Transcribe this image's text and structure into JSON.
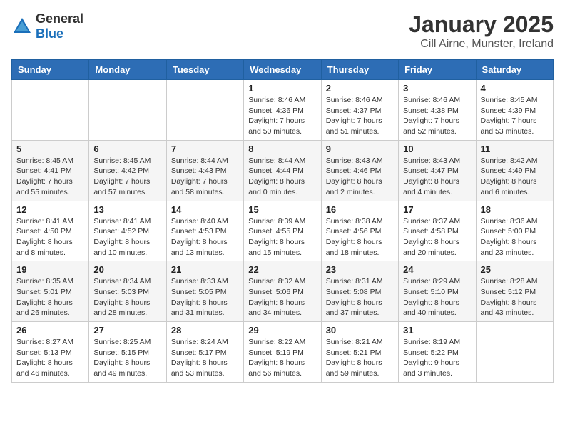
{
  "logo": {
    "general": "General",
    "blue": "Blue"
  },
  "title": "January 2025",
  "subtitle": "Cill Airne, Munster, Ireland",
  "days_header": [
    "Sunday",
    "Monday",
    "Tuesday",
    "Wednesday",
    "Thursday",
    "Friday",
    "Saturday"
  ],
  "weeks": [
    [
      {
        "day": "",
        "info": ""
      },
      {
        "day": "",
        "info": ""
      },
      {
        "day": "",
        "info": ""
      },
      {
        "day": "1",
        "info": "Sunrise: 8:46 AM\nSunset: 4:36 PM\nDaylight: 7 hours\nand 50 minutes."
      },
      {
        "day": "2",
        "info": "Sunrise: 8:46 AM\nSunset: 4:37 PM\nDaylight: 7 hours\nand 51 minutes."
      },
      {
        "day": "3",
        "info": "Sunrise: 8:46 AM\nSunset: 4:38 PM\nDaylight: 7 hours\nand 52 minutes."
      },
      {
        "day": "4",
        "info": "Sunrise: 8:45 AM\nSunset: 4:39 PM\nDaylight: 7 hours\nand 53 minutes."
      }
    ],
    [
      {
        "day": "5",
        "info": "Sunrise: 8:45 AM\nSunset: 4:41 PM\nDaylight: 7 hours\nand 55 minutes."
      },
      {
        "day": "6",
        "info": "Sunrise: 8:45 AM\nSunset: 4:42 PM\nDaylight: 7 hours\nand 57 minutes."
      },
      {
        "day": "7",
        "info": "Sunrise: 8:44 AM\nSunset: 4:43 PM\nDaylight: 7 hours\nand 58 minutes."
      },
      {
        "day": "8",
        "info": "Sunrise: 8:44 AM\nSunset: 4:44 PM\nDaylight: 8 hours\nand 0 minutes."
      },
      {
        "day": "9",
        "info": "Sunrise: 8:43 AM\nSunset: 4:46 PM\nDaylight: 8 hours\nand 2 minutes."
      },
      {
        "day": "10",
        "info": "Sunrise: 8:43 AM\nSunset: 4:47 PM\nDaylight: 8 hours\nand 4 minutes."
      },
      {
        "day": "11",
        "info": "Sunrise: 8:42 AM\nSunset: 4:49 PM\nDaylight: 8 hours\nand 6 minutes."
      }
    ],
    [
      {
        "day": "12",
        "info": "Sunrise: 8:41 AM\nSunset: 4:50 PM\nDaylight: 8 hours\nand 8 minutes."
      },
      {
        "day": "13",
        "info": "Sunrise: 8:41 AM\nSunset: 4:52 PM\nDaylight: 8 hours\nand 10 minutes."
      },
      {
        "day": "14",
        "info": "Sunrise: 8:40 AM\nSunset: 4:53 PM\nDaylight: 8 hours\nand 13 minutes."
      },
      {
        "day": "15",
        "info": "Sunrise: 8:39 AM\nSunset: 4:55 PM\nDaylight: 8 hours\nand 15 minutes."
      },
      {
        "day": "16",
        "info": "Sunrise: 8:38 AM\nSunset: 4:56 PM\nDaylight: 8 hours\nand 18 minutes."
      },
      {
        "day": "17",
        "info": "Sunrise: 8:37 AM\nSunset: 4:58 PM\nDaylight: 8 hours\nand 20 minutes."
      },
      {
        "day": "18",
        "info": "Sunrise: 8:36 AM\nSunset: 5:00 PM\nDaylight: 8 hours\nand 23 minutes."
      }
    ],
    [
      {
        "day": "19",
        "info": "Sunrise: 8:35 AM\nSunset: 5:01 PM\nDaylight: 8 hours\nand 26 minutes."
      },
      {
        "day": "20",
        "info": "Sunrise: 8:34 AM\nSunset: 5:03 PM\nDaylight: 8 hours\nand 28 minutes."
      },
      {
        "day": "21",
        "info": "Sunrise: 8:33 AM\nSunset: 5:05 PM\nDaylight: 8 hours\nand 31 minutes."
      },
      {
        "day": "22",
        "info": "Sunrise: 8:32 AM\nSunset: 5:06 PM\nDaylight: 8 hours\nand 34 minutes."
      },
      {
        "day": "23",
        "info": "Sunrise: 8:31 AM\nSunset: 5:08 PM\nDaylight: 8 hours\nand 37 minutes."
      },
      {
        "day": "24",
        "info": "Sunrise: 8:29 AM\nSunset: 5:10 PM\nDaylight: 8 hours\nand 40 minutes."
      },
      {
        "day": "25",
        "info": "Sunrise: 8:28 AM\nSunset: 5:12 PM\nDaylight: 8 hours\nand 43 minutes."
      }
    ],
    [
      {
        "day": "26",
        "info": "Sunrise: 8:27 AM\nSunset: 5:13 PM\nDaylight: 8 hours\nand 46 minutes."
      },
      {
        "day": "27",
        "info": "Sunrise: 8:25 AM\nSunset: 5:15 PM\nDaylight: 8 hours\nand 49 minutes."
      },
      {
        "day": "28",
        "info": "Sunrise: 8:24 AM\nSunset: 5:17 PM\nDaylight: 8 hours\nand 53 minutes."
      },
      {
        "day": "29",
        "info": "Sunrise: 8:22 AM\nSunset: 5:19 PM\nDaylight: 8 hours\nand 56 minutes."
      },
      {
        "day": "30",
        "info": "Sunrise: 8:21 AM\nSunset: 5:21 PM\nDaylight: 8 hours\nand 59 minutes."
      },
      {
        "day": "31",
        "info": "Sunrise: 8:19 AM\nSunset: 5:22 PM\nDaylight: 9 hours\nand 3 minutes."
      },
      {
        "day": "",
        "info": ""
      }
    ]
  ]
}
